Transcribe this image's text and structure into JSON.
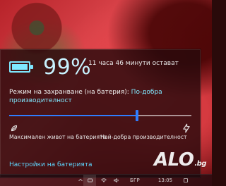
{
  "battery": {
    "percent_text": "99%",
    "percent_value": 99,
    "time_remaining": "11 часа 46 минути остават"
  },
  "power_mode": {
    "title_prefix": "Режим на захранване (на батерия): ",
    "selected_mode": "По-добра производителност",
    "slider_position": 0.7,
    "min_label": "Максимален живот на батерията",
    "max_label": "Най-добра производителност",
    "left_icon": "leaf-icon",
    "right_icon": "bolt-icon"
  },
  "links": {
    "battery_settings": "Настройки на батерията"
  },
  "taskbar": {
    "language": "БГР",
    "time": "13:05"
  },
  "watermark": {
    "main": "ALO",
    "suffix": ".bg"
  },
  "colors": {
    "accent": "#2f7dff",
    "cyan": "#7fe8ff",
    "link": "#5ed7ff"
  }
}
